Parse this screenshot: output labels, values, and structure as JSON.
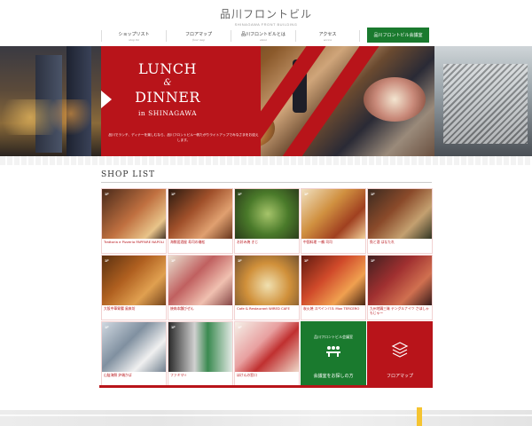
{
  "header": {
    "logo_jp": "品川フロントビル",
    "logo_en": "SHINAGAWA FRONT BUILDING",
    "nav": [
      {
        "jp": "ショップリスト",
        "en": "shop list"
      },
      {
        "jp": "フロアマップ",
        "en": "floor map"
      },
      {
        "jp": "品川フロントビルとは",
        "en": "about"
      },
      {
        "jp": "アクセス",
        "en": "access"
      }
    ],
    "cta": "品川フロントビル会議室"
  },
  "hero": {
    "title_line1": "LUNCH",
    "amp": "&",
    "title_line2": "DINNER",
    "title_line3": "in SHINAGAWA",
    "desc": "品川でランチ、ディナーを楽しむなら、品川フロントビル一帆たがりライトアップでみなさまをお迎えします。"
  },
  "shop_list": {
    "title": "SHOP LIST",
    "shops": [
      {
        "floor": "1F",
        "name": "Trattoria e Pizzeria PAPPARE NAPOLI"
      },
      {
        "floor": "1F",
        "name": "海鮮居酒屋 寿司の磯松"
      },
      {
        "floor": "1F",
        "name": "お好み焼 きじ"
      },
      {
        "floor": "1F",
        "name": "中国料理 一鶴 司司"
      },
      {
        "floor": "1F",
        "name": "魚と酒 はなたれ"
      },
      {
        "floor": "1F",
        "name": "大阪中華胃腸 風来坊"
      },
      {
        "floor": "1F",
        "name": "焼肉本舗びぜん"
      },
      {
        "floor": "1F",
        "name": "Cafe & Restaurant WIRED CAFE"
      },
      {
        "floor": "1F",
        "name": "炭火焼 スペインバル Mon TERCERO"
      },
      {
        "floor": "1F",
        "name": "九州地鶏三昧 テングルナイツ さほしゃもじゃー"
      },
      {
        "floor": "1F",
        "name": "山陰海鮮 炉端かば"
      },
      {
        "floor": "1F",
        "name": "ファミマ!!"
      },
      {
        "floor": "1F",
        "name": "ほけんの窓口"
      }
    ],
    "room_title": "品川フロントビル会議室",
    "room_label": "会議室をお探しの方",
    "floormap_label": "フロアマップ"
  },
  "colors": {
    "accent_red": "#b8141a",
    "accent_green": "#1a7a2e"
  }
}
